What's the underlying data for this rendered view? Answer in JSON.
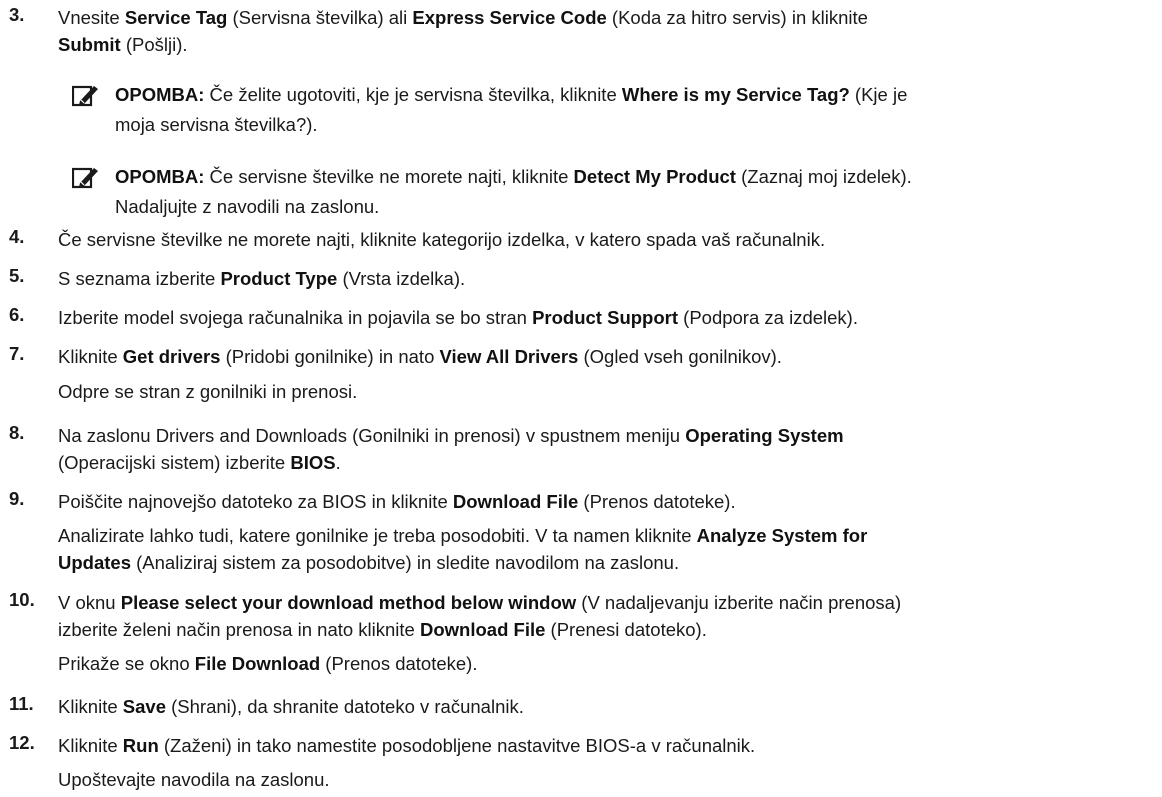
{
  "steps": [
    {
      "num": "3.",
      "parts": [
        "Vnesite ",
        "Service Tag",
        " (Servisna številka) ali ",
        "Express Service Code",
        " (Koda za hitro servis) in kliknite "
      ],
      "line2": [
        "Submit",
        " (Pošlji)."
      ]
    },
    {
      "num": "4.",
      "text": "Če servisne številke ne morete najti, kliknite kategorijo izdelka, v katero spada vaš računalnik."
    },
    {
      "num": "5.",
      "parts": [
        "S seznama izberite ",
        "Product Type",
        " (Vrsta izdelka)."
      ]
    },
    {
      "num": "6.",
      "parts": [
        "Izberite model svojega računalnika in pojavila se bo stran ",
        "Product Support",
        " (Podpora za izdelek)."
      ]
    },
    {
      "num": "7.",
      "parts": [
        "Kliknite ",
        "Get drivers",
        " (Pridobi gonilnike) in nato ",
        "View All Drivers",
        " (Ogled vseh gonilnikov)."
      ],
      "sub": "Odpre se stran z gonilniki in prenosi."
    },
    {
      "num": "8.",
      "parts": [
        "Na zaslonu Drivers and Downloads (Gonilniki in prenosi) v spustnem meniju ",
        "Operating System"
      ],
      "line2": [
        "(Operacijski sistem) izberite ",
        "BIOS",
        "."
      ]
    },
    {
      "num": "9.",
      "parts": [
        "Poiščite najnovejšo datoteko za BIOS in kliknite ",
        "Download File",
        " (Prenos datoteke)."
      ],
      "sub1": [
        "Analizirate lahko tudi, katere gonilnike je treba posodobiti. V ta namen kliknite ",
        "Analyze System for"
      ],
      "sub2": [
        "Updates",
        " (Analiziraj sistem za posodobitve) in sledite navodilom na zaslonu."
      ]
    },
    {
      "num": "10.",
      "parts": [
        "V oknu ",
        "Please select your download method below window",
        " (V nadaljevanju izberite način prenosa)"
      ],
      "line2": [
        "izberite želeni način prenosa in nato kliknite ",
        "Download File",
        " (Prenesi datoteko)."
      ],
      "sub": [
        "Prikaže se okno ",
        "File Download",
        " (Prenos datoteke)."
      ]
    },
    {
      "num": "11.",
      "parts": [
        "Kliknite ",
        "Save",
        " (Shrani), da shranite datoteko v računalnik."
      ]
    },
    {
      "num": "12.",
      "parts": [
        "Kliknite ",
        "Run",
        " (Zaženi) in tako namestite posodobljene nastavitve BIOS-a v računalnik."
      ],
      "sub": "Upoštevajte navodila na zaslonu."
    }
  ],
  "notes": [
    {
      "label": "OPOMBA:",
      "parts": [
        " Če želite ugotoviti, kje je servisna številka, kliknite ",
        "Where is my Service Tag?",
        " (Kje je"
      ],
      "line2": "moja servisna številka?)."
    },
    {
      "label": "OPOMBA:",
      "parts": [
        " Če servisne številke ne morete najti, kliknite ",
        "Detect My Product",
        " (Zaznaj moj izdelek)."
      ],
      "line2": "Nadaljujte z navodili na zaslonu."
    }
  ],
  "icon": {
    "name": "note-pencil-icon",
    "color": "#1a1a1a"
  }
}
